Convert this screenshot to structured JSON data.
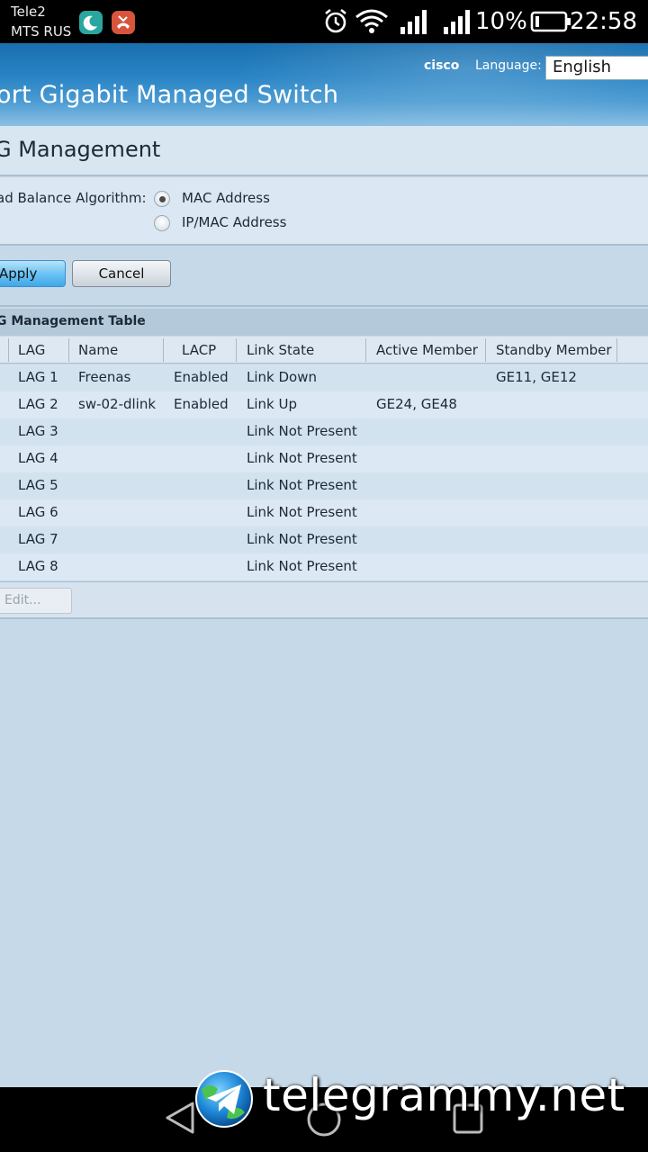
{
  "status_bar": {
    "carrier1": "Tele2",
    "carrier2": "MTS RUS",
    "battery_percent": "10%",
    "time": "22:58"
  },
  "header": {
    "title": "ort Gigabit Managed Switch",
    "brand": "cisco",
    "language_label": "Language:",
    "language_value": "English"
  },
  "page": {
    "title": "G Management"
  },
  "settings": {
    "algorithm_label": "ad Balance Algorithm:",
    "options": [
      {
        "label": "MAC Address",
        "checked": true
      },
      {
        "label": "IP/MAC Address",
        "checked": false
      }
    ]
  },
  "buttons": {
    "apply": "Apply",
    "cancel": "Cancel",
    "edit": "Edit..."
  },
  "table": {
    "caption": "G Management Table",
    "columns": [
      "LAG",
      "Name",
      "LACP",
      "Link State",
      "Active Member",
      "Standby Member"
    ],
    "rows": [
      {
        "lag": "LAG 1",
        "name": "Freenas",
        "lacp": "Enabled",
        "state": "Link Down",
        "active": "",
        "standby": "GE11, GE12"
      },
      {
        "lag": "LAG 2",
        "name": "sw-02-dlink",
        "lacp": "Enabled",
        "state": "Link Up",
        "active": "GE24, GE48",
        "standby": ""
      },
      {
        "lag": "LAG 3",
        "name": "",
        "lacp": "",
        "state": "Link Not Present",
        "active": "",
        "standby": ""
      },
      {
        "lag": "LAG 4",
        "name": "",
        "lacp": "",
        "state": "Link Not Present",
        "active": "",
        "standby": ""
      },
      {
        "lag": "LAG 5",
        "name": "",
        "lacp": "",
        "state": "Link Not Present",
        "active": "",
        "standby": ""
      },
      {
        "lag": "LAG 6",
        "name": "",
        "lacp": "",
        "state": "Link Not Present",
        "active": "",
        "standby": ""
      },
      {
        "lag": "LAG 7",
        "name": "",
        "lacp": "",
        "state": "Link Not Present",
        "active": "",
        "standby": ""
      },
      {
        "lag": "LAG 8",
        "name": "",
        "lacp": "",
        "state": "Link Not Present",
        "active": "",
        "standby": ""
      }
    ]
  },
  "watermark": {
    "text": "telegrammy.net"
  },
  "icons": {
    "status": [
      "moon-app-icon",
      "missed-call-icon",
      "alarm-icon",
      "wifi-icon",
      "signal-icon",
      "signal-icon",
      "battery-icon"
    ],
    "nav": [
      "back-icon",
      "home-icon",
      "recents-icon"
    ]
  },
  "colors": {
    "banner": "#2883c4",
    "apply_button": "#6cc3f3",
    "page_background": "#c6d9e8"
  }
}
